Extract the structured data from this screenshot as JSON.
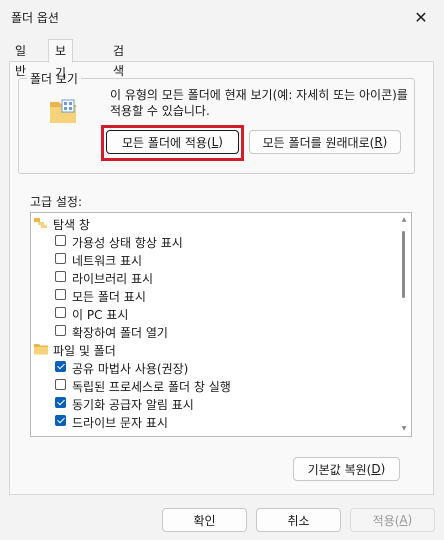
{
  "window": {
    "title": "폴더 옵션",
    "close_glyph": "✕"
  },
  "tabs": [
    {
      "label": "일반",
      "active": false
    },
    {
      "label": "보기",
      "active": true
    },
    {
      "label": "검색",
      "active": false
    }
  ],
  "folder_view": {
    "title": "폴더 보기",
    "description": "이 유형의 모든 폴더에 현재 보기(예: 자세히 또는 아이콘)를 적용할 수 있습니다.",
    "apply_button": {
      "text": "모든 폴더에 적용(",
      "key": "L",
      "end": ")"
    },
    "reset_button": {
      "text": "모든 폴더를 원래대로(",
      "key": "R",
      "end": ")"
    }
  },
  "advanced": {
    "label": "고급 설정:",
    "items": [
      {
        "type": "folder",
        "label": "탐색 창",
        "icon": "navigation-pane-icon"
      },
      {
        "type": "checkbox",
        "label": "가용성 상태 항상 표시",
        "checked": false
      },
      {
        "type": "checkbox",
        "label": "네트워크 표시",
        "checked": false
      },
      {
        "type": "checkbox",
        "label": "라이브러리 표시",
        "checked": false
      },
      {
        "type": "checkbox",
        "label": "모든 폴더 표시",
        "checked": false
      },
      {
        "type": "checkbox",
        "label": "이 PC 표시",
        "checked": false
      },
      {
        "type": "checkbox",
        "label": "확장하여 폴더 열기",
        "checked": false
      },
      {
        "type": "folder",
        "label": "파일 및 폴더",
        "icon": "folder-icon"
      },
      {
        "type": "checkbox",
        "label": "공유 마법사 사용(권장)",
        "checked": true
      },
      {
        "type": "checkbox",
        "label": "독립된 프로세스로 폴더 창 실행",
        "checked": false
      },
      {
        "type": "checkbox",
        "label": "동기화 공급자 알림 표시",
        "checked": true
      },
      {
        "type": "checkbox",
        "label": "드라이브 문자 표시",
        "checked": true
      }
    ],
    "restore_button": {
      "text": "기본값 복원(",
      "key": "D",
      "end": ")"
    }
  },
  "footer": {
    "ok": "확인",
    "cancel": "취소",
    "apply": {
      "text": "적용(",
      "key": "A",
      "end": ")"
    }
  },
  "colors": {
    "accent": "#0a5fb8",
    "highlight": "#d21d2b"
  }
}
